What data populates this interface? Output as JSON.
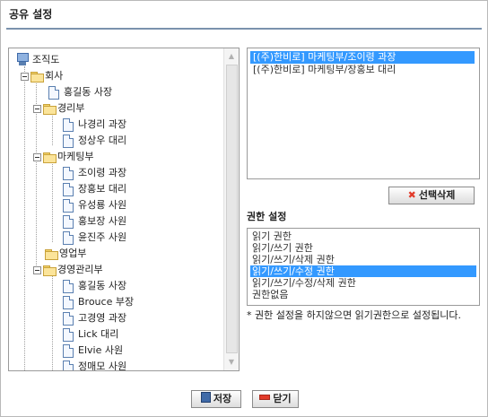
{
  "page": {
    "title": "공유 설정"
  },
  "tree": {
    "root": "조직도",
    "items": [
      {
        "label": "회사",
        "type": "folder"
      },
      {
        "label": "홍길동 사장",
        "type": "user"
      },
      {
        "label": "경리부",
        "type": "folder"
      },
      {
        "label": "나경리 과장",
        "type": "user"
      },
      {
        "label": "정상우 대리",
        "type": "user"
      },
      {
        "label": "마케팅부",
        "type": "folder"
      },
      {
        "label": "조이령 과장",
        "type": "user"
      },
      {
        "label": "장홍보 대리",
        "type": "user"
      },
      {
        "label": "유성룡 사원",
        "type": "user"
      },
      {
        "label": "홍보장 사원",
        "type": "user"
      },
      {
        "label": "윤진주 사원",
        "type": "user"
      },
      {
        "label": "영업부",
        "type": "folder"
      },
      {
        "label": "경영관리부",
        "type": "folder"
      },
      {
        "label": "홍길동 사장",
        "type": "user"
      },
      {
        "label": "Brouce 부장",
        "type": "user"
      },
      {
        "label": "고경영 과장",
        "type": "user"
      },
      {
        "label": "Lick 대리",
        "type": "user"
      },
      {
        "label": "Elvie 사원",
        "type": "user"
      },
      {
        "label": "정매모 사원",
        "type": "user"
      }
    ]
  },
  "selected": {
    "items": [
      "[(주)한비로] 마케팅부/조이령 과장",
      "[(주)한비로] 마케팅부/장홍보 대리"
    ],
    "active_index": 0
  },
  "buttons": {
    "delete_label": "선택삭제",
    "save_label": "저장",
    "close_label": "닫기"
  },
  "permissions": {
    "label": "권한 설정",
    "options": [
      "읽기 권한",
      "읽기/쓰기 권한",
      "읽기/쓰기/삭제 권한",
      "읽기/쓰기/수정 권한",
      "읽기/쓰기/수정/삭제 권한",
      "권한없음"
    ],
    "active_index": 3
  },
  "note": "* 권한 설정을 하지않으면 읽기권한으로 설정됩니다."
}
